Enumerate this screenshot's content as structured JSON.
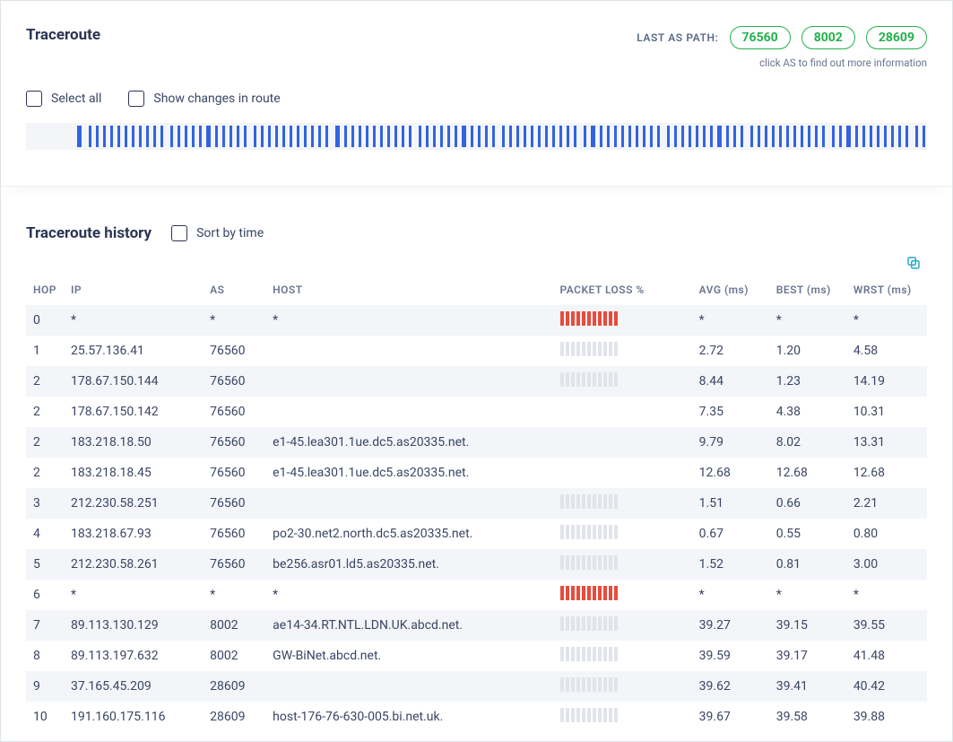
{
  "top": {
    "title": "Traceroute",
    "as_path_label": "LAST AS PATH:",
    "as_path": [
      "76560",
      "8002",
      "28609"
    ],
    "as_hint": "click AS to find out more information",
    "select_all_label": "Select all",
    "show_changes_label": "Show changes in route"
  },
  "history": {
    "title": "Traceroute history",
    "sort_label": "Sort by time",
    "columns": {
      "hop": "HOP",
      "ip": "IP",
      "as": "AS",
      "host": "HOST",
      "pkt": "PACKET LOSS %",
      "avg": "AVG (ms)",
      "best": "BEST (ms)",
      "wrst": "WRST (ms)"
    },
    "rows": [
      {
        "hop": "0",
        "ip": "*",
        "as": "*",
        "host": "*",
        "pkt": "full",
        "avg": "*",
        "best": "*",
        "wrst": "*"
      },
      {
        "hop": "1",
        "ip": "25.57.136.41",
        "as": "76560",
        "host": "",
        "pkt": "empty",
        "avg": "2.72",
        "best": "1.20",
        "wrst": "4.58"
      },
      {
        "hop": "2",
        "ip": "178.67.150.144",
        "as": "76560",
        "host": "",
        "pkt": "empty",
        "avg": "8.44",
        "best": "1.23",
        "wrst": "14.19"
      },
      {
        "hop": "2",
        "ip": "178.67.150.142",
        "as": "76560",
        "host": "",
        "pkt": "none",
        "avg": "7.35",
        "best": "4.38",
        "wrst": "10.31"
      },
      {
        "hop": "2",
        "ip": "183.218.18.50",
        "as": "76560",
        "host": "e1-45.lea301.1ue.dc5.as20335.net.",
        "pkt": "none",
        "avg": "9.79",
        "best": "8.02",
        "wrst": "13.31"
      },
      {
        "hop": "2",
        "ip": "183.218.18.45",
        "as": "76560",
        "host": "e1-45.lea301.1ue.dc5.as20335.net.",
        "pkt": "none",
        "avg": "12.68",
        "best": "12.68",
        "wrst": "12.68"
      },
      {
        "hop": "3",
        "ip": "212.230.58.251",
        "as": "76560",
        "host": "",
        "pkt": "empty",
        "avg": "1.51",
        "best": "0.66",
        "wrst": "2.21"
      },
      {
        "hop": "4",
        "ip": "183.218.67.93",
        "as": "76560",
        "host": "po2-30.net2.north.dc5.as20335.net.",
        "pkt": "empty",
        "avg": "0.67",
        "best": "0.55",
        "wrst": "0.80"
      },
      {
        "hop": "5",
        "ip": "212.230.58.261",
        "as": "76560",
        "host": "be256.asr01.ld5.as20335.net.",
        "pkt": "empty",
        "avg": "1.52",
        "best": "0.81",
        "wrst": "3.00"
      },
      {
        "hop": "6",
        "ip": "*",
        "as": "*",
        "host": "*",
        "pkt": "full",
        "avg": "*",
        "best": "*",
        "wrst": "*"
      },
      {
        "hop": "7",
        "ip": "89.113.130.129",
        "as": "8002",
        "host": "ae14-34.RT.NTL.LDN.UK.abcd.net.",
        "pkt": "empty",
        "avg": "39.27",
        "best": "39.15",
        "wrst": "39.55"
      },
      {
        "hop": "8",
        "ip": "89.113.197.632",
        "as": "8002",
        "host": "GW-BiNet.abcd.net.",
        "pkt": "empty",
        "avg": "39.59",
        "best": "39.17",
        "wrst": "41.48"
      },
      {
        "hop": "9",
        "ip": "37.165.45.209",
        "as": "28609",
        "host": "",
        "pkt": "empty",
        "avg": "39.62",
        "best": "39.41",
        "wrst": "40.42"
      },
      {
        "hop": "10",
        "ip": "191.160.175.116",
        "as": "28609",
        "host": "host-176-76-630-005.bi.net.uk.",
        "pkt": "empty",
        "avg": "39.67",
        "best": "39.58",
        "wrst": "39.88"
      }
    ]
  }
}
